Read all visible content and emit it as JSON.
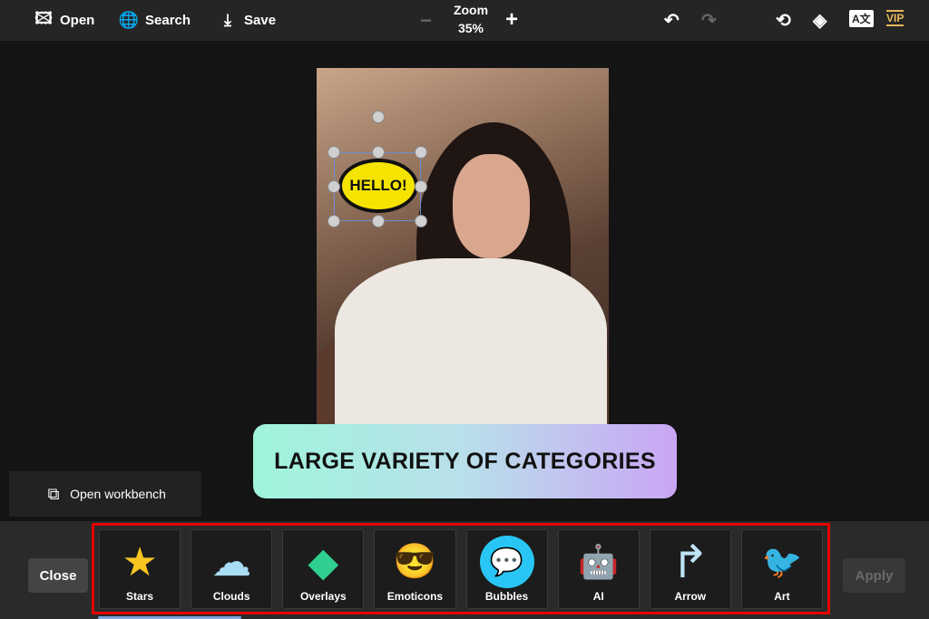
{
  "toolbar": {
    "open": "Open",
    "search": "Search",
    "save": "Save",
    "zoom_label": "Zoom",
    "zoom_value": "35%",
    "vip": "VIP"
  },
  "canvas": {
    "sticker_text": "HELLO!",
    "banner": "LARGE VARIETY OF CATEGORIES",
    "workbench": "Open workbench"
  },
  "bottom": {
    "close": "Close",
    "apply": "Apply",
    "categories": [
      {
        "label": "Stars",
        "icon": "★"
      },
      {
        "label": "Clouds",
        "icon": "☁"
      },
      {
        "label": "Overlays",
        "icon": "◆"
      },
      {
        "label": "Emoticons",
        "icon": "😎"
      },
      {
        "label": "Bubbles",
        "icon": "💬"
      },
      {
        "label": "AI",
        "icon": "🤖"
      },
      {
        "label": "Arrow",
        "icon": "↱"
      },
      {
        "label": "Art",
        "icon": "🐦"
      }
    ]
  },
  "colors": {
    "highlight": "#e50000",
    "vip": "#e6b85c"
  }
}
